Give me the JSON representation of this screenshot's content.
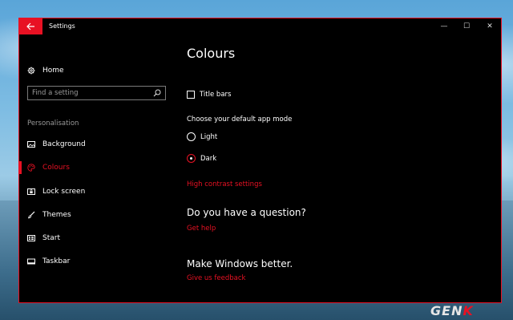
{
  "titlebar": {
    "back_icon": "back-arrow-icon",
    "title": "Settings",
    "minimize_glyph": "—",
    "maximize_glyph": "☐",
    "close_glyph": "✕"
  },
  "nav": {
    "home_label": "Home",
    "search_placeholder": "Find a setting",
    "section_label": "Personalisation",
    "items": [
      {
        "label": "Background",
        "icon": "picture-icon"
      },
      {
        "label": "Colours",
        "icon": "palette-icon",
        "active": true
      },
      {
        "label": "Lock screen",
        "icon": "lock-screen-icon"
      },
      {
        "label": "Themes",
        "icon": "brush-icon"
      },
      {
        "label": "Start",
        "icon": "start-grid-icon"
      },
      {
        "label": "Taskbar",
        "icon": "taskbar-icon"
      }
    ]
  },
  "content": {
    "title": "Colours",
    "title_bars_label": "Title bars",
    "title_bars_checked": false,
    "mode_label": "Choose your default app mode",
    "modes": [
      {
        "label": "Light",
        "selected": false
      },
      {
        "label": "Dark",
        "selected": true
      }
    ],
    "high_contrast_link": "High contrast settings",
    "question_heading": "Do you have a question?",
    "get_help_link": "Get help",
    "better_heading": "Make Windows better.",
    "feedback_link": "Give us feedback"
  },
  "watermark": {
    "prefix": "GEN",
    "suffix": "K"
  },
  "colors": {
    "accent": "#e81123",
    "background": "#000000",
    "text": "#ffffff"
  }
}
